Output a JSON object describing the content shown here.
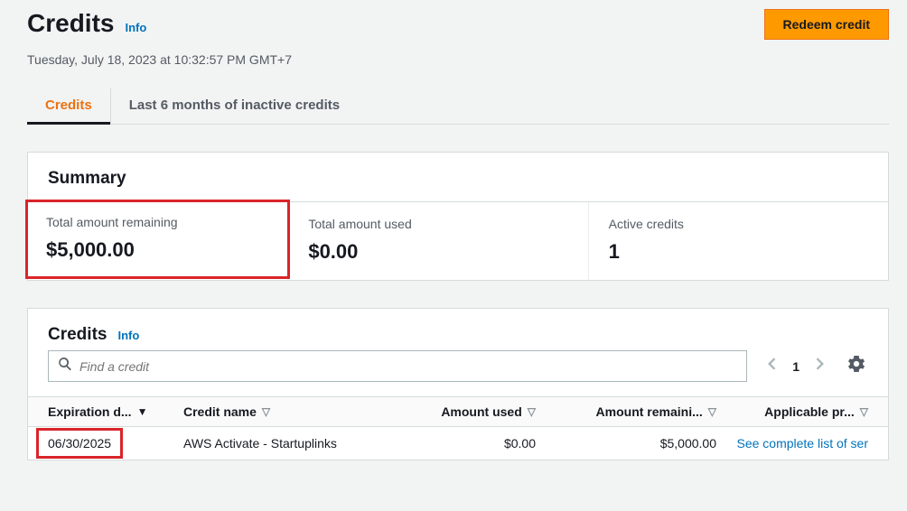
{
  "header": {
    "title": "Credits",
    "info_label": "Info",
    "redeem_label": "Redeem credit",
    "timestamp": "Tuesday, July 18, 2023 at 10:32:57 PM GMT+7"
  },
  "tabs": [
    {
      "label": "Credits",
      "active": true
    },
    {
      "label": "Last 6 months of inactive credits",
      "active": false
    }
  ],
  "summary": {
    "title": "Summary",
    "remaining_label": "Total amount remaining",
    "remaining_value": "$5,000.00",
    "used_label": "Total amount used",
    "used_value": "$0.00",
    "active_label": "Active credits",
    "active_value": "1"
  },
  "credits_section": {
    "title": "Credits",
    "info_label": "Info",
    "search_placeholder": "Find a credit",
    "page_number": "1",
    "columns": {
      "expiration": "Expiration d...",
      "name": "Credit name",
      "used": "Amount used",
      "remaining": "Amount remaini...",
      "applicable": "Applicable pr..."
    },
    "rows": [
      {
        "expiration": "06/30/2025",
        "name": "AWS Activate - Startuplinks",
        "used": "$0.00",
        "remaining": "$5,000.00",
        "applicable": "See complete list of ser"
      }
    ]
  }
}
